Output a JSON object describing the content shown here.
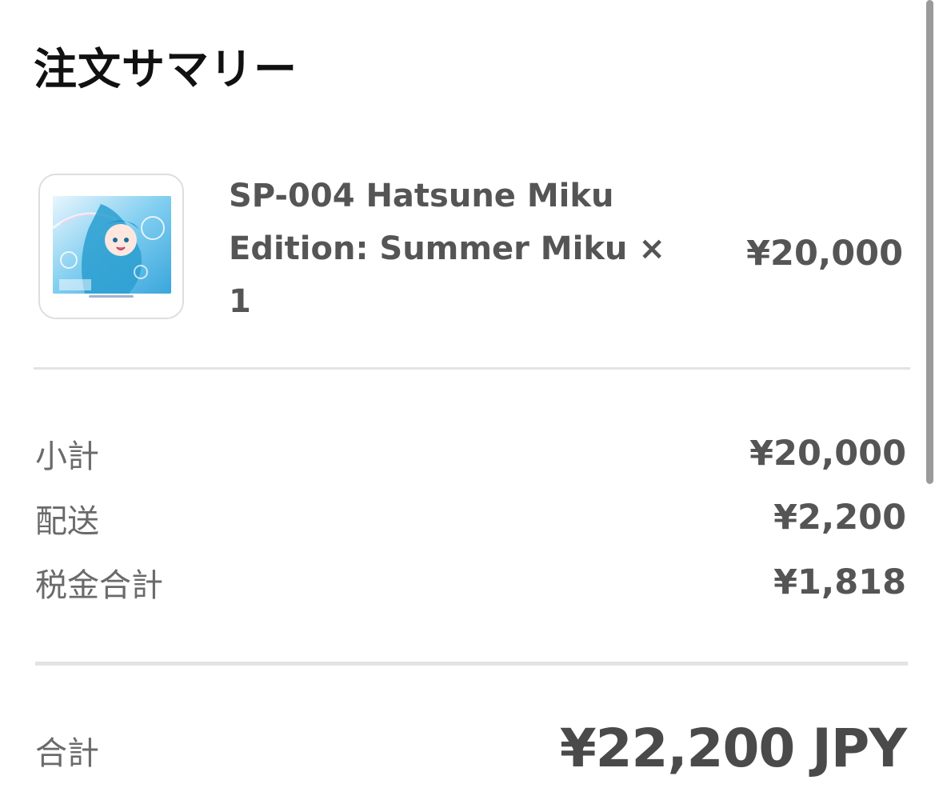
{
  "summary": {
    "title": "注文サマリー"
  },
  "item": {
    "name": "SP-004 Hatsune Miku Edition: Summer Miku × 1",
    "price": "¥20,000"
  },
  "breakdown": {
    "subtotal_label": "小計",
    "subtotal_value": "¥20,000",
    "shipping_label": "配送",
    "shipping_value": "¥2,200",
    "tax_label": "税金合計",
    "tax_value": "¥1,818"
  },
  "total": {
    "label": "合計",
    "value": "¥22,200 JPY"
  },
  "colors": {
    "heading": "#111111",
    "text": "#555555",
    "label": "#6a6a6a",
    "divider": "#e3e3e3"
  }
}
